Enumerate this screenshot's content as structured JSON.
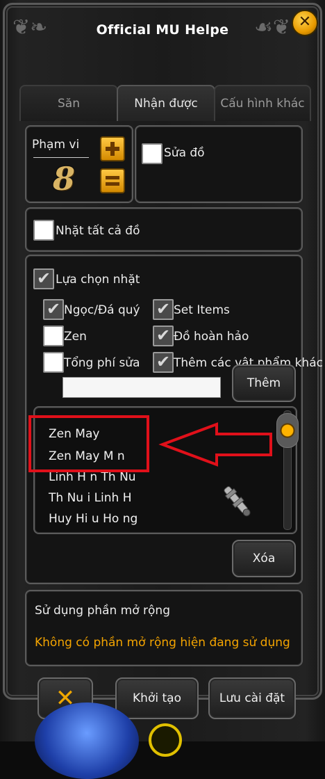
{
  "window": {
    "title": "Official MU Helpe"
  },
  "tabs": [
    {
      "label": "Săn"
    },
    {
      "label": "Nhận được"
    },
    {
      "label": "Cấu hình khác"
    }
  ],
  "range": {
    "label": "Phạm vi",
    "value": "8"
  },
  "repair": {
    "label": "Sửa đồ",
    "checked": false
  },
  "pickup_all": {
    "label": "Nhặt tất cả đồ",
    "checked": false
  },
  "selection": {
    "label": "Lựa chọn nhặt",
    "checked": true,
    "options": [
      {
        "label": "Ngọc/Đá quý",
        "checked": true
      },
      {
        "label": "Set Items",
        "checked": true
      },
      {
        "label": "Zen",
        "checked": false
      },
      {
        "label": "Đồ hoàn hảo",
        "checked": true
      },
      {
        "label": "Tổng phí sửa",
        "checked": false
      },
      {
        "label": "Thêm các vật phẩm khác",
        "checked": true
      }
    ],
    "input_value": "",
    "add_button": "Thêm"
  },
  "item_list": {
    "items": [
      "Zen May",
      "Zen May M n",
      "Linh H n Th  Nu",
      "Th  Nu i Linh H",
      "Huy Hi u Ho ng"
    ],
    "highlight_color": "#e0101a",
    "delete_button": "Xóa"
  },
  "extension": {
    "title": "Sử dụng phần mở rộng",
    "status": "Không có phần mở rộng hiện đang sử dụng"
  },
  "footer": {
    "init_button": "Khởi tạo",
    "save_button": "Lưu cài đặt"
  },
  "colors": {
    "accent": "#f4a400",
    "annotation": "#e0101a"
  }
}
